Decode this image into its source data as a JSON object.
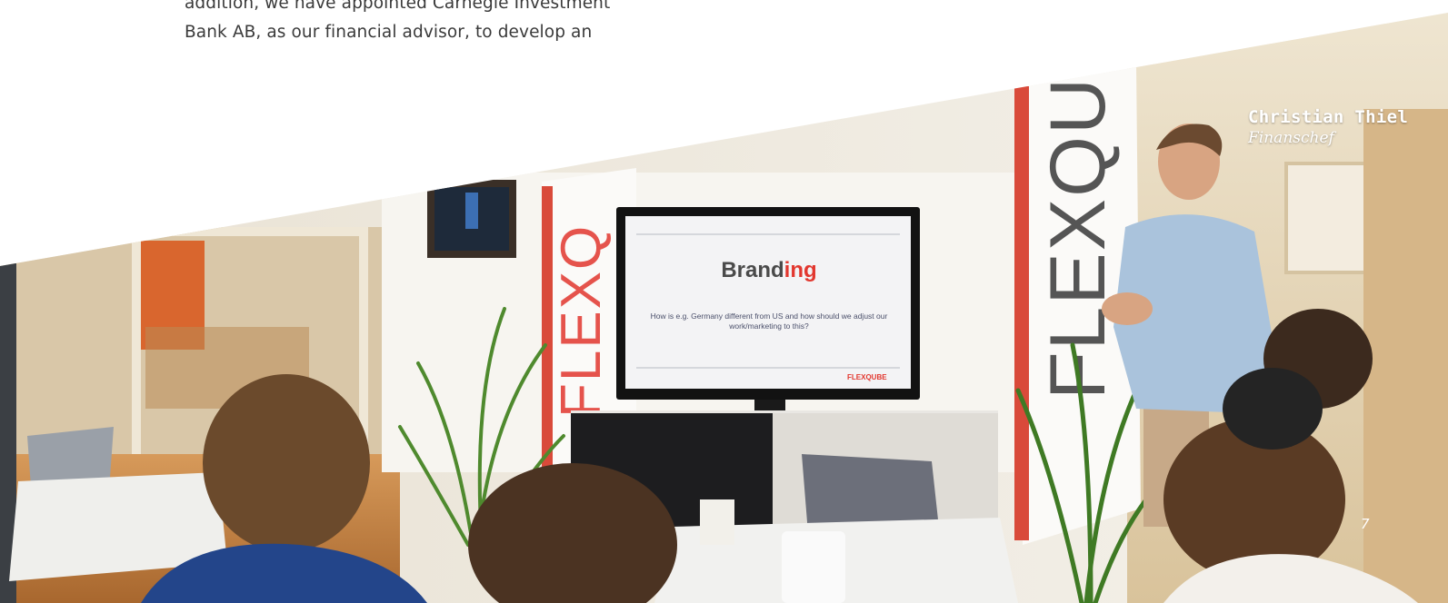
{
  "document": {
    "body_lines": [
      "addition, we have appointed Carnegie Investment",
      "Bank AB, as our financial advisor, to develop an"
    ]
  },
  "photo": {
    "caption_name": "Christian Thiel",
    "caption_role": "Finanschef",
    "screen_title_part1": "Brand",
    "screen_title_part2": "ing",
    "screen_subtitle": "How is e.g. Germany different from US and how should we adjust our work/marketing to this?",
    "screen_logo": "FLEXQUBE",
    "banner_text": "FLEXQUBE",
    "page_number": "7"
  },
  "colors": {
    "accent_red": "#e2372f",
    "text_gray": "#3a3a3a",
    "shirt_blue": "#aac3dc"
  }
}
